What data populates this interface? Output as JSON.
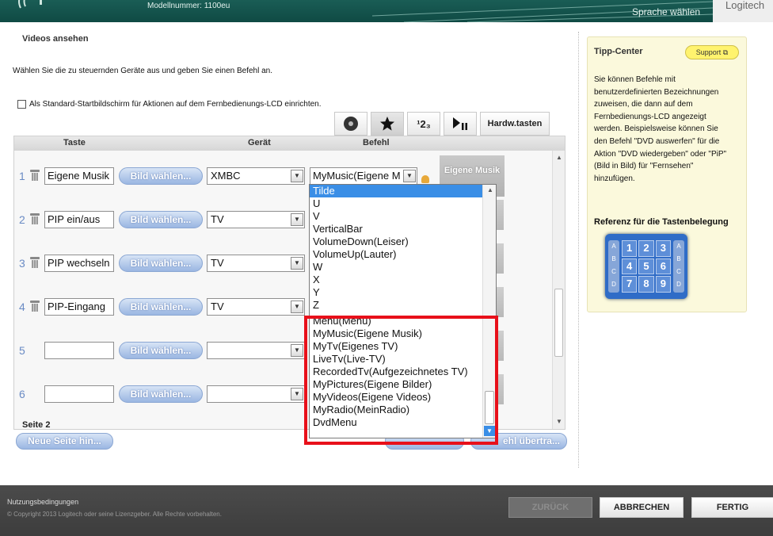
{
  "header": {
    "model_number": "Modellnummer: 1100eu",
    "language_link": "Sprache wählen",
    "brand": "Logitech"
  },
  "page": {
    "section_title": "Videos ansehen",
    "instruction": "Wählen Sie die zu steuernden Geräte aus und geben Sie einen Befehl an.",
    "default_screen_checkbox": "Als Standard-Startbildschirm für Aktionen auf dem Fernbedienungs-LCD einrichten."
  },
  "tabs": {
    "hardware_label": "Hardw.tasten",
    "numbers_label": "¹2₃",
    "icons": [
      "disc-icon",
      "star-icon",
      "numbers-icon",
      "play-pause-icon"
    ]
  },
  "table": {
    "headers": {
      "key": "Taste",
      "device": "Gerät",
      "command": "Befehl"
    },
    "image_button": "Bild wählen...",
    "rows": [
      {
        "num": "1",
        "key": "Eigene Musik",
        "device": "XMBC",
        "command": "MyMusic(Eigene M",
        "label": "Eigene Musik"
      },
      {
        "num": "2",
        "key": "PIP ein/aus",
        "device": "TV"
      },
      {
        "num": "3",
        "key": "PIP wechseln",
        "device": "TV"
      },
      {
        "num": "4",
        "key": "PIP-Eingang",
        "device": "TV"
      },
      {
        "num": "5",
        "key": "",
        "device": ""
      },
      {
        "num": "6",
        "key": "",
        "device": ""
      }
    ],
    "page_label": "Seite 2"
  },
  "dropdown": {
    "selected": "Tilde",
    "items": [
      "U",
      "V",
      "VerticalBar",
      "VolumeDown(Leiser)",
      "VolumeUp(Lauter)",
      "W",
      "X",
      "Y",
      "Z"
    ],
    "highlighted_items": [
      "Menu(Menü)",
      "MyMusic(Eigene Musik)",
      "MyTv(Eigenes TV)",
      "LiveTv(Live-TV)",
      "RecordedTv(Aufgezeichnetes TV)",
      "MyPictures(Eigene Bilder)",
      "MyVideos(Eigene Videos)",
      "MyRadio(MeinRadio)",
      "DvdMenu"
    ]
  },
  "buttons": {
    "new_page": "Neue Seite hin...",
    "send_command": "ehl übertra..."
  },
  "tip_center": {
    "title": "Tipp-Center",
    "support": "Support",
    "lines": [
      "Sie können Befehle mit",
      "benutzerdefinierten Bezeichnungen",
      "zuweisen, die dann auf dem",
      "Fernbedienungs-LCD angezeigt",
      "werden. Beispielsweise können Sie",
      "den Befehl \"DVD auswerfen\" für die",
      "Aktion \"DVD wiedergeben\" oder \"PiP\"",
      "(Bild in Bild) für \"Fernsehen\"",
      "hinzufügen."
    ],
    "reference_title": "Referenz für die Tastenbelegung",
    "keypad_keys": [
      "1",
      "2",
      "3",
      "4",
      "5",
      "6",
      "7",
      "8",
      "9"
    ],
    "keypad_side_left": [
      "A",
      "B",
      "C",
      "D"
    ],
    "keypad_side_right": [
      "A",
      "B",
      "C",
      "D"
    ]
  },
  "footer": {
    "terms": "Nutzungsbedingungen",
    "copyright": "© Copyright 2013 Logitech oder seine Lizenzgeber. Alle Rechte vorbehalten.",
    "back": "ZURÜCK",
    "cancel": "ABBRECHEN",
    "finish": "FERTIG"
  },
  "colors": {
    "header_bg": "#155650",
    "accent_blue": "#3a8ee6",
    "highlight_red": "#e8101a",
    "tip_bg": "#fbf9dc"
  }
}
